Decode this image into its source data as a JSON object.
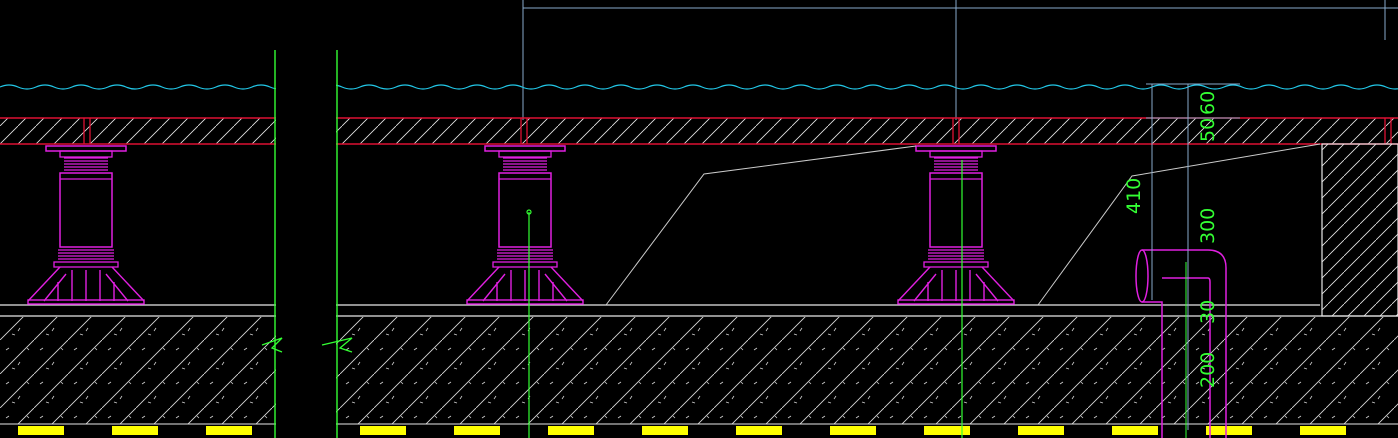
{
  "drawing": {
    "colors": {
      "background": "#000000",
      "slab": "#dd1133",
      "pedestal": "#e020e0",
      "water": "#22c8e8",
      "dimension": "#33ff33",
      "outline": "#e8e8e8",
      "construction_line": "#88aacc",
      "ground_hatch": "#d8d8d8",
      "waterproof_band": "#ffff00"
    },
    "dimensions": {
      "d60": "60",
      "d50": "50",
      "d410": "410",
      "d300": "300",
      "d30": "30",
      "d200": "200"
    },
    "elements": {
      "pedestal_count": 3,
      "wall_break_symbols": 2
    }
  }
}
